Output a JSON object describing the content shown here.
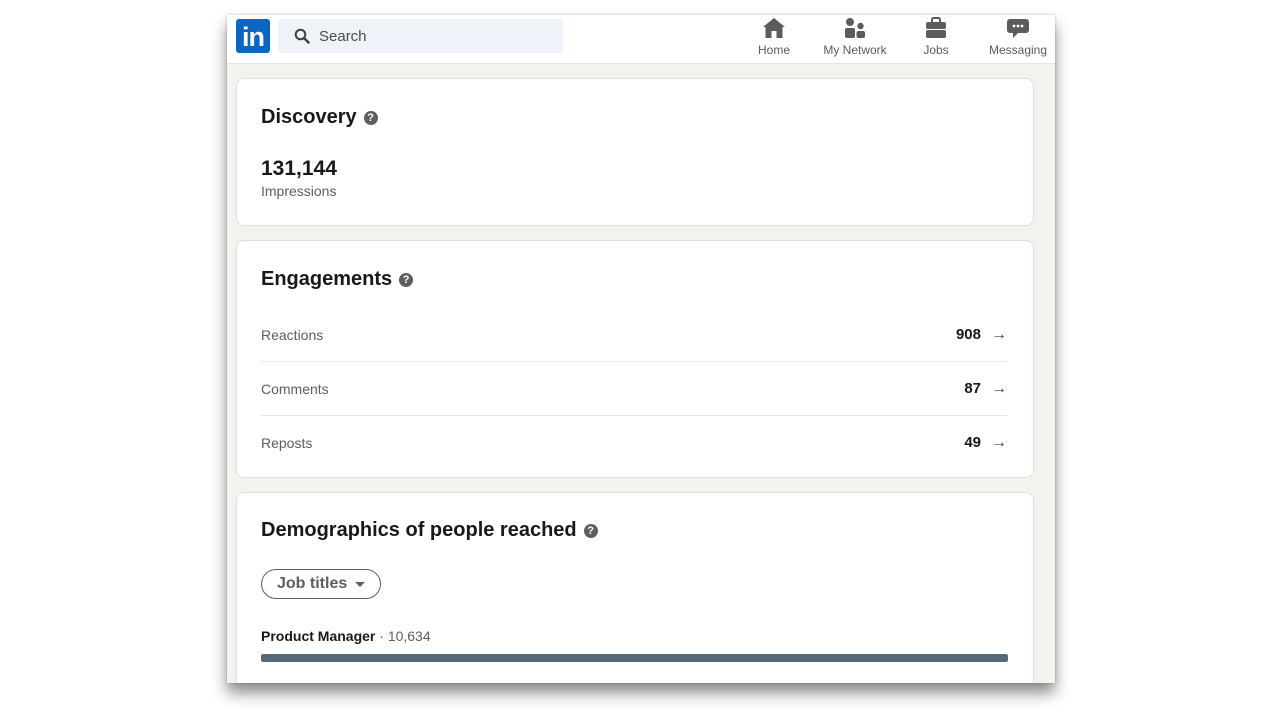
{
  "topbar": {
    "logo_text": "in",
    "search_placeholder": "Search",
    "nav": [
      {
        "label": "Home",
        "icon": "home-icon"
      },
      {
        "label": "My Network",
        "icon": "my-network-icon"
      },
      {
        "label": "Jobs",
        "icon": "jobs-icon"
      },
      {
        "label": "Messaging",
        "icon": "messaging-icon"
      }
    ]
  },
  "discovery": {
    "title": "Discovery",
    "help_glyph": "?",
    "impressions_value": "131,144",
    "impressions_label": "Impressions"
  },
  "engagements": {
    "title": "Engagements",
    "help_glyph": "?",
    "rows": [
      {
        "label": "Reactions",
        "value": "908",
        "arrow": "→"
      },
      {
        "label": "Comments",
        "value": "87",
        "arrow": "→"
      },
      {
        "label": "Reposts",
        "value": "49",
        "arrow": "→"
      }
    ]
  },
  "demographics": {
    "title": "Demographics of people reached",
    "help_glyph": "?",
    "filter_label": "Job titles",
    "items": [
      {
        "title": "Product Manager",
        "separator": " · ",
        "count": "10,634",
        "bar_fraction": 1.0
      }
    ]
  },
  "colors": {
    "brand": "#0a66c2",
    "page_bg": "#f3f2ef",
    "search_bg": "#edf3f8",
    "bar_fill": "#56687a"
  }
}
